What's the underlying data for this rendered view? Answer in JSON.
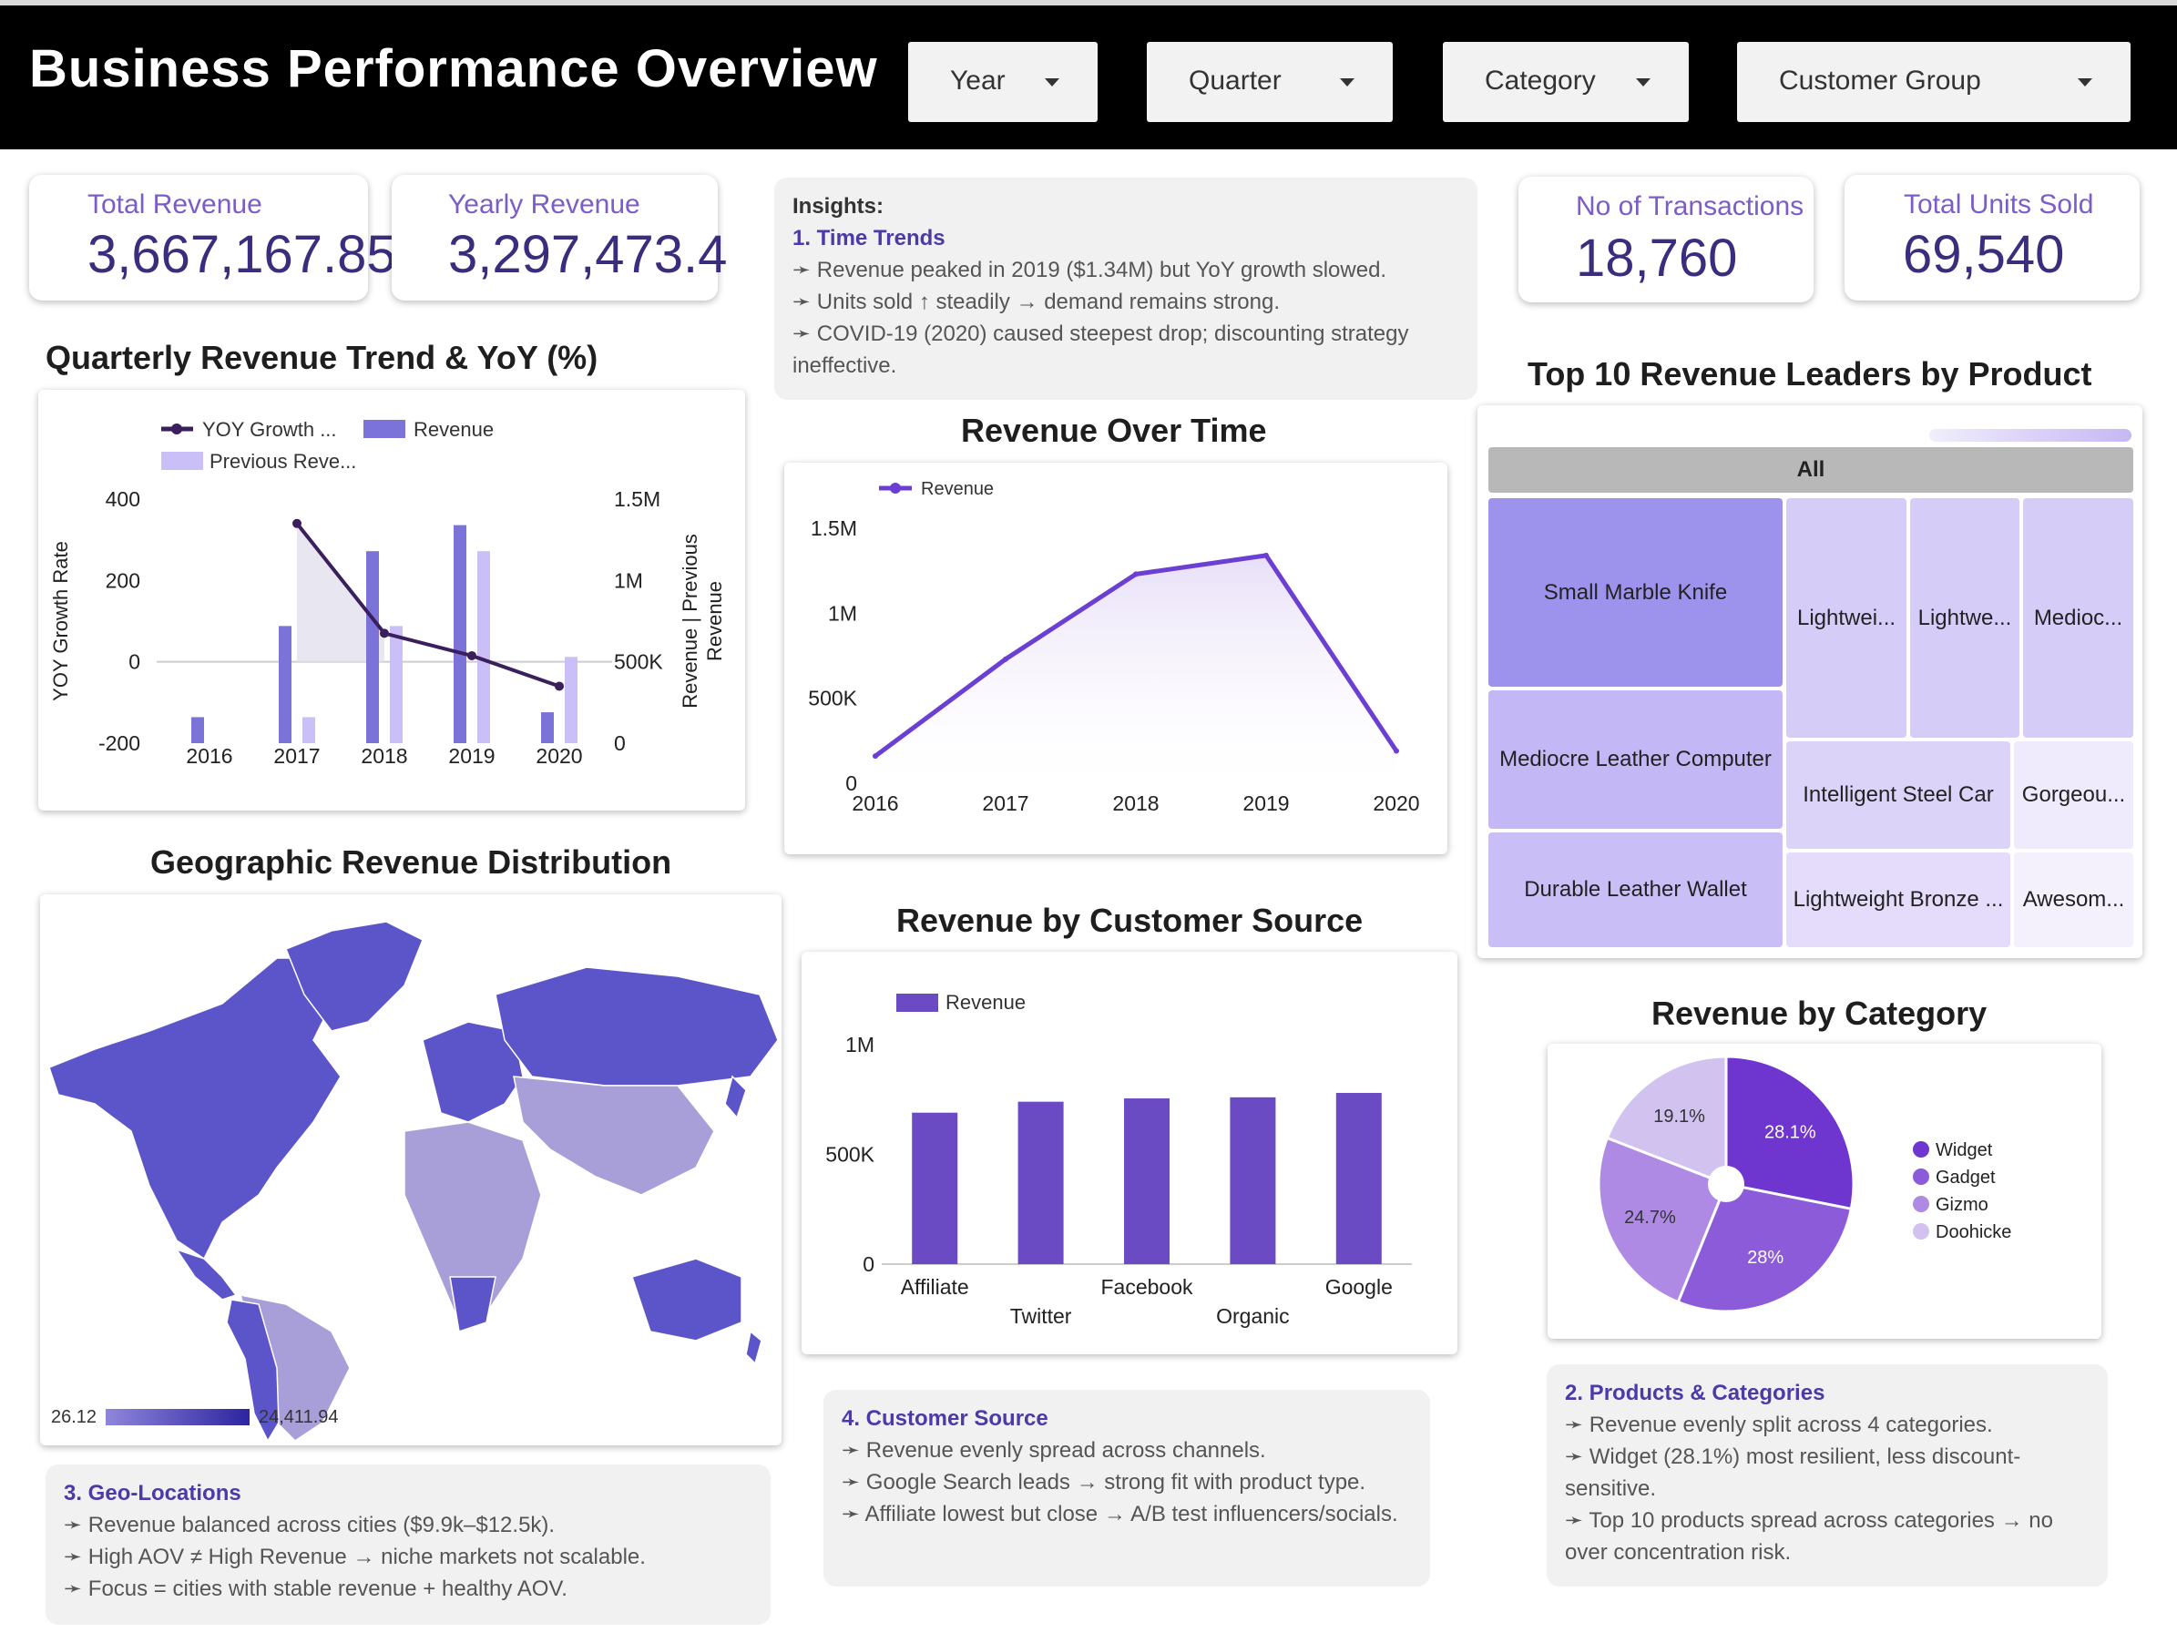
{
  "header": {
    "title": "Business Performance Overview",
    "filters": [
      "Year",
      "Quarter",
      "Category",
      "Customer Group"
    ]
  },
  "kpis": {
    "total_revenue": {
      "label": "Total Revenue",
      "value": "3,667,167.85"
    },
    "yearly_revenue": {
      "label": "Yearly Revenue",
      "value": "3,297,473.4"
    },
    "transactions": {
      "label": "No of Transactions",
      "value": "18,760"
    },
    "units_sold": {
      "label": "Total Units Sold",
      "value": "69,540"
    }
  },
  "insights": {
    "heading": "Insights:",
    "title": "1. Time Trends",
    "lines": [
      "➛ Revenue peaked in 2019 ($1.34M) but YoY growth slowed.",
      "➛ Units sold ↑ steadily → demand remains strong.",
      "➛ COVID-19 (2020) caused steepest drop; discounting strategy ineffective."
    ]
  },
  "notes": {
    "geo": {
      "title": "3. Geo-Locations",
      "lines": [
        "➛  Revenue balanced across cities ($9.9k–$12.5k).",
        "➛  High AOV ≠ High Revenue → niche markets not scalable.",
        "➛  Focus = cities with stable revenue + healthy AOV."
      ]
    },
    "source": {
      "title": "4. Customer Source",
      "lines": [
        "➛  Revenue evenly spread across channels.",
        "➛  Google Search leads → strong fit with product type.",
        "➛  Affiliate lowest but close → A/B test influencers/socials."
      ]
    },
    "products": {
      "title": "2. Products & Categories",
      "lines": [
        "➛  Revenue evenly split across 4 categories.",
        "➛  Widget (28.1%) most resilient, less discount-sensitive.",
        "➛  Top 10 products spread across categories → no over concentration risk."
      ]
    }
  },
  "titles": {
    "quarterly": "Quarterly Revenue Trend & YoY (%)",
    "over_time": "Revenue Over Time",
    "geo": "Geographic Revenue Distribution",
    "source": "Revenue by Customer Source",
    "top10": "Top 10 Revenue Leaders by Product",
    "category": "Revenue by Category"
  },
  "chart_data": [
    {
      "id": "quarterly",
      "type": "bar",
      "categories": [
        "2016",
        "2017",
        "2018",
        "2019",
        "2020"
      ],
      "series": [
        {
          "name": "YOY Growth ...",
          "type": "line",
          "values": [
            null,
            340,
            70,
            15,
            -60
          ]
        },
        {
          "name": "Revenue",
          "type": "bar",
          "values": [
            160000,
            720000,
            1180000,
            1340000,
            190000
          ]
        },
        {
          "name": "Previous Reve...",
          "type": "bar",
          "values": [
            0,
            160000,
            720000,
            1180000,
            530000
          ]
        }
      ],
      "ylabel_left": "YOY Growth Rate",
      "ylabel_right": "Revenue | Previous Revenue",
      "y_left_ticks": [
        "400",
        "200",
        "0",
        "-200"
      ],
      "y_left_range": [
        -200,
        400
      ],
      "y_right_ticks": [
        "1.5M",
        "1M",
        "500K",
        "0"
      ],
      "y_right_range": [
        0,
        1500000
      ],
      "colors": {
        "line": "#3a1f5c",
        "revenue": "#7c73d9",
        "previous": "#cbbff7"
      }
    },
    {
      "id": "over_time",
      "type": "area",
      "x": [
        "2016",
        "2017",
        "2018",
        "2019",
        "2020"
      ],
      "series": [
        {
          "name": "Revenue",
          "values": [
            160000,
            730000,
            1230000,
            1340000,
            190000
          ]
        }
      ],
      "y_ticks": [
        "1.5M",
        "1M",
        "500K",
        "0"
      ],
      "ylim": [
        0,
        1500000
      ],
      "colors": {
        "line": "#6a3fd1",
        "fill": "#e8dff8"
      }
    },
    {
      "id": "source",
      "type": "bar",
      "categories": [
        "Affiliate",
        "Twitter",
        "Facebook",
        "Organic",
        "Google"
      ],
      "series": [
        {
          "name": "Revenue",
          "values": [
            690000,
            740000,
            755000,
            760000,
            780000
          ]
        }
      ],
      "y_ticks": [
        "1M",
        "500K",
        "0"
      ],
      "ylim": [
        0,
        1000000
      ],
      "colors": {
        "bar": "#6a4bc4"
      }
    },
    {
      "id": "category",
      "type": "pie",
      "labels": [
        "Widget",
        "Gadget",
        "Gizmo",
        "Doohickey"
      ],
      "legend_labels": [
        "Widget",
        "Gadget",
        "Gizmo",
        "Doohicke"
      ],
      "values": [
        28.1,
        28,
        24.7,
        19.1
      ],
      "slice_labels": [
        "28.1%",
        "28%",
        "24.7%",
        "19.1%"
      ],
      "colors": [
        "#6f35cf",
        "#8b5bd9",
        "#ae8ae4",
        "#d1c2ef"
      ]
    },
    {
      "id": "top10",
      "type": "treemap",
      "root": "All",
      "labels": [
        "Small Marble Knife",
        "Mediocre Leather Computer",
        "Durable Leather Wallet",
        "Lightwei...",
        "Lightwe...",
        "Medioc...",
        "Intelligent Steel Car",
        "Gorgeou...",
        "Lightweight Bronze ...",
        "Awesom..."
      ]
    }
  ],
  "map": {
    "legend_min": "26.12",
    "legend_max": "24,411.94",
    "colors": {
      "low": "#a89fd8",
      "high": "#5c55c9"
    }
  }
}
